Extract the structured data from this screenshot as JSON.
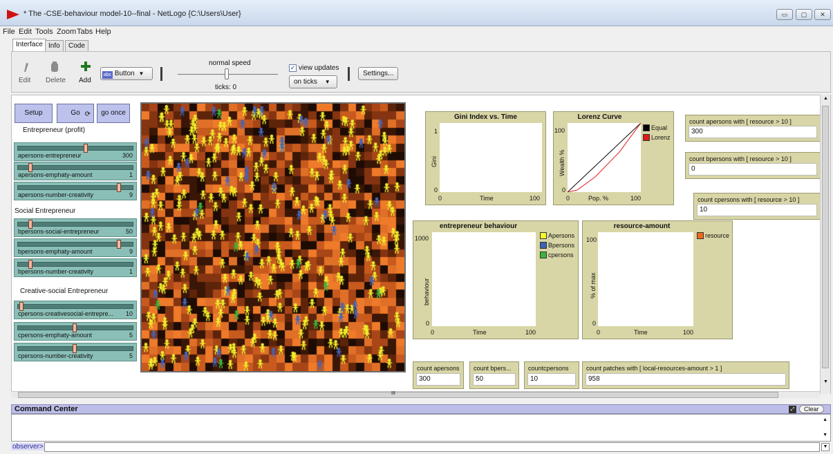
{
  "window": {
    "title": "* The -CSE-behaviour model-10--final - NetLogo {C:\\Users\\User}",
    "controls": [
      "▭",
      "▢",
      "✕"
    ]
  },
  "menu": [
    "File",
    "Edit",
    "Tools",
    "Zoom",
    "Tabs",
    "Help"
  ],
  "tabs": [
    "Interface",
    "Info",
    "Code"
  ],
  "toolbar": {
    "edit": "Edit",
    "delete": "Delete",
    "add": "Add",
    "widget_type": "Button",
    "speed_label": "normal speed",
    "ticks_label": "ticks: 0",
    "view_updates_label": "view updates",
    "view_updates_checked": true,
    "update_mode": "on ticks",
    "settings": "Settings..."
  },
  "buttons": {
    "setup": "Setup",
    "go": "Go",
    "go_once": "go once"
  },
  "notes": {
    "n1": "Entrepreneur (profit)",
    "n2": "Social Entrepreneur",
    "n3": "Creative-social Entrepreneur"
  },
  "sliders": [
    {
      "name": "apersons-entrepreneur",
      "value": "300",
      "pos": 0.6
    },
    {
      "name": "apersons-emphaty-amount",
      "value": "1",
      "pos": 0.1
    },
    {
      "name": "apersons-number-creativity",
      "value": "9",
      "pos": 0.9
    },
    {
      "name": "bpersons-social-entrepreneur",
      "value": "50",
      "pos": 0.1
    },
    {
      "name": "bpersons-emphaty-amount",
      "value": "9",
      "pos": 0.9
    },
    {
      "name": "bpersons-number-creativity",
      "value": "1",
      "pos": 0.1
    },
    {
      "name": "cpersons-creativesocial-entrepre...",
      "value": "10",
      "pos": 0.02
    },
    {
      "name": "cpersons-emphaty-amount",
      "value": "5",
      "pos": 0.5
    },
    {
      "name": "cpersons-number-creativity",
      "value": "5",
      "pos": 0.5
    }
  ],
  "plots": {
    "gini": {
      "title": "Gini Index vs. Time",
      "ymax": "1",
      "ymin": "0",
      "xmin": "0",
      "xmax": "100",
      "xlabel": "Time",
      "ylabel": "Gini"
    },
    "lorenz": {
      "title": "Lorenz Curve",
      "ymax": "100",
      "ymin": "0",
      "xmin": "0",
      "xmax": "100",
      "xlabel": "Pop. %",
      "ylabel": "Wealth %",
      "legend": [
        {
          "name": "Equal",
          "color": "#000000"
        },
        {
          "name": "Lorenz",
          "color": "#e01b1b"
        }
      ]
    },
    "behaviour": {
      "title": "entrepreneur behaviour",
      "ymax": "1000",
      "ymin": "0",
      "xmin": "0",
      "xmax": "100",
      "xlabel": "Time",
      "ylabel": "behaviour",
      "legend": [
        {
          "name": "Apersons",
          "color": "#f4f430"
        },
        {
          "name": "Bpersons",
          "color": "#3a64b4"
        },
        {
          "name": "cpersons",
          "color": "#3cb43c"
        }
      ]
    },
    "resource": {
      "title": "resource-amount",
      "ymax": "100",
      "ymin": "0",
      "xmin": "0",
      "xmax": "100",
      "xlabel": "Time",
      "ylabel": "% of max",
      "legend": [
        {
          "name": "resource",
          "color": "#ee6a1a"
        }
      ]
    }
  },
  "monitors": {
    "m1": {
      "label": "count apersons with [ resource > 10 ]",
      "value": "300"
    },
    "m2": {
      "label": "count bpersons with [ resource > 10 ]",
      "value": "0"
    },
    "m3": {
      "label": "count cpersons with [ resource > 10 ]",
      "value": "10"
    },
    "m4": {
      "label": "count apersons",
      "value": "300"
    },
    "m5": {
      "label": "count bpers...",
      "value": "50"
    },
    "m6": {
      "label": "countcpersons",
      "value": "10"
    },
    "m7": {
      "label": "count patches with [ local-resources-amount > 1 ]",
      "value": "958"
    }
  },
  "scroll_marker": "III",
  "command_center": {
    "title": "Command Center",
    "clear": "Clear",
    "prompt": "observer>",
    "input": ""
  }
}
